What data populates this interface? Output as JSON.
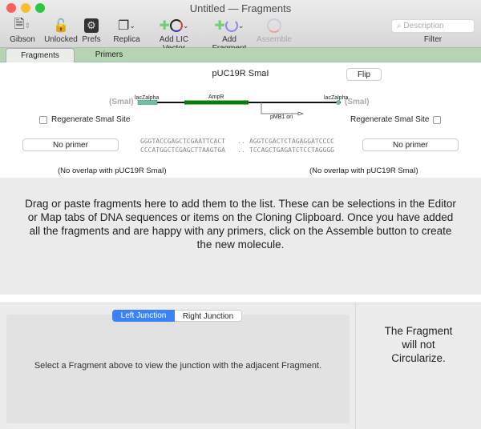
{
  "window": {
    "title": "Untitled — Fragments"
  },
  "toolbar": {
    "items": [
      {
        "label": "Gibson",
        "icon": "gibson-doc-icon",
        "enabled": true
      },
      {
        "label": "Unlocked",
        "icon": "unlocked-padlock-icon",
        "enabled": true
      },
      {
        "label": "Prefs",
        "icon": "prefs-gear-icon",
        "enabled": true
      },
      {
        "label": "Replica",
        "icon": "replica-windows-icon",
        "enabled": true
      },
      {
        "label": "Add LIC Vector",
        "icon": "add-lic-vector-icon",
        "enabled": true
      },
      {
        "label": "Add Fragment",
        "icon": "add-fragment-icon",
        "enabled": true
      },
      {
        "label": "Assemble",
        "icon": "assemble-icon",
        "enabled": false
      }
    ],
    "search_placeholder": "Description",
    "filter_label": "Filter"
  },
  "tabs": [
    {
      "label": "Fragments",
      "selected": true
    },
    {
      "label": "Primers",
      "selected": false
    }
  ],
  "fragment": {
    "name": "pUC19R SmaI",
    "flip_label": "Flip",
    "left_site": "(SmaI)",
    "right_site": "(SmaI)",
    "features": [
      "lacZalpha",
      "AmpR",
      "lacZalpha",
      "pMB1 ori"
    ],
    "regen_left": "Regenerate SmaI Site",
    "regen_right": "Regenerate SmaI Site",
    "primer_left": "No primer",
    "primer_right": "No primer",
    "seq_top_left": "GGGTACCGAGCTCGAATTCACT",
    "seq_top_right": "AGGTCGACTCTAGAGGATCCCC",
    "seq_bot_left": "CCCATGGCTCGAGCTTAAGTGA",
    "seq_bot_right": "TCCAGCTGAGATCTCCTAGGGG",
    "ellipsis": "..",
    "overlap_left": "(No overlap with pUC19R SmaI)",
    "overlap_right": "(No overlap with pUC19R SmaI)"
  },
  "drop_text": "Drag or paste fragments here to add them to the list. These can be selections in the Editor or Map tabs of DNA sequences or items on the Cloning Clipboard. Once you have added all the fragments and are happy with any primers, click on the Assemble button to create the new molecule.",
  "junction": {
    "left_tab": "Left Junction",
    "right_tab": "Right Junction",
    "message": "Select a Fragment above to view the junction with the adjacent Fragment."
  },
  "circularize": "The Fragment will not Circularize.",
  "colors": {
    "tab_green": "#b6d4b2",
    "ampr": "#0a7a0a",
    "lacz": "#6cc2a0",
    "selected_seg": "#3b82f6"
  }
}
